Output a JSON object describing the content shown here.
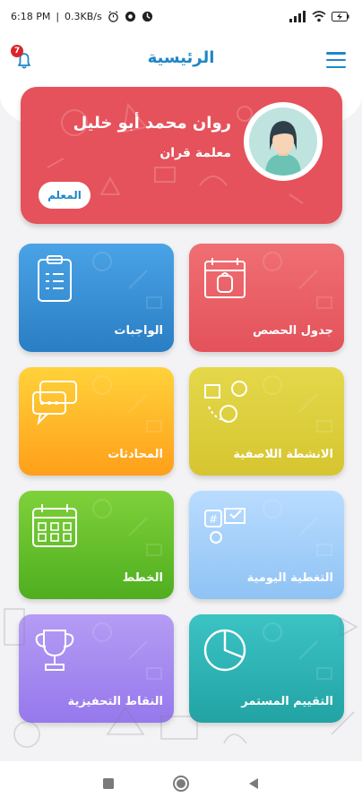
{
  "status_bar": {
    "time": "6:18 PM",
    "speed": "0.3KB/s",
    "battery_icon": "battery-charging-icon",
    "wifi_icon": "wifi-icon",
    "signal_icon": "signal-icon"
  },
  "header": {
    "title": "الرئيسية",
    "menu_icon": "hamburger-menu-icon",
    "notification_icon": "bell-icon",
    "notification_count": "7"
  },
  "profile": {
    "name": "روان محمد أبو خليل",
    "role": "معلمة قران",
    "badge": "المعلم",
    "card_color": "#e5525b"
  },
  "tiles": [
    {
      "label": "جدول الحصص",
      "icon": "calendar-backpack-icon",
      "color_top": "#ef6f73",
      "color_bottom": "#e4525a"
    },
    {
      "label": "الواجبات",
      "icon": "clipboard-list-icon",
      "color_top": "#4aa3e6",
      "color_bottom": "#2a7ec4"
    },
    {
      "label": "الانشطة اللاصفية",
      "icon": "activities-icon",
      "color_top": "#e4d84a",
      "color_bottom": "#d6c530"
    },
    {
      "label": "المحادثات",
      "icon": "chat-bubbles-icon",
      "color_top": "#ffd23a",
      "color_bottom": "#ff9f1a"
    },
    {
      "label": "التغطية اليومية",
      "icon": "daily-coverage-icon",
      "color_top": "#b9dcff",
      "color_bottom": "#8fc3f4"
    },
    {
      "label": "الخطط",
      "icon": "calendar-grid-icon",
      "color_top": "#7fd13a",
      "color_bottom": "#4fae1f"
    },
    {
      "label": "التقييم المستمر",
      "icon": "pie-chart-icon",
      "color_top": "#3cc3c4",
      "color_bottom": "#22a3a4"
    },
    {
      "label": "النقاط التحفيزية",
      "icon": "trophy-icon",
      "color_top": "#b59cf4",
      "color_bottom": "#9678ec"
    }
  ],
  "nav": {
    "recent_icon": "square-recent-icon",
    "home_icon": "circle-home-icon",
    "back_icon": "triangle-back-icon"
  }
}
